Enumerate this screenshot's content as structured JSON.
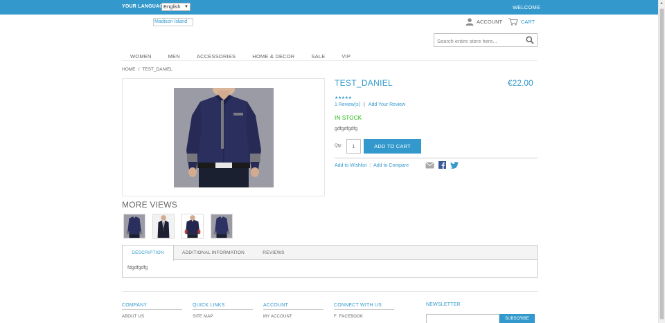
{
  "topbar": {
    "language_label": "YOUR LANGUAGE:",
    "language_value": "English",
    "welcome": "WELCOME"
  },
  "header": {
    "logo_alt": "Madison Island",
    "account": "ACCOUNT",
    "cart": "CART",
    "search_placeholder": "Search entire store here..."
  },
  "nav": [
    "WOMEN",
    "MEN",
    "ACCESSORIES",
    "HOME & DECOR",
    "SALE",
    "VIP"
  ],
  "breadcrumb": {
    "home": "HOME",
    "sep": "/",
    "current": "TEST_DANIEL"
  },
  "product": {
    "name": "TEST_DANIEL",
    "price": "€22.00",
    "rating_stars": "★★★★★",
    "reviews_count": "1 Review(s)",
    "reviews_sep": "|",
    "add_review": "Add Your Review",
    "availability": "IN STOCK",
    "short_description": "gdfgdfgdfg",
    "qty_label": "Qty:",
    "qty_value": "1",
    "add_to_cart": "ADD TO CART",
    "add_to_wishlist": "Add to Wishlist",
    "links_sep": "|",
    "add_to_compare": "Add to Compare"
  },
  "more_views": {
    "title": "MORE VIEWS",
    "count": 4
  },
  "tabs": {
    "items": [
      "DESCRIPTION",
      "ADDITIONAL INFORMATION",
      "REVIEWS"
    ],
    "active": "DESCRIPTION",
    "content": "fdgdfgdfg"
  },
  "footer": {
    "columns": [
      {
        "heading": "COMPANY",
        "link": "ABOUT US"
      },
      {
        "heading": "QUICK LINKS",
        "link": "SITE MAP"
      },
      {
        "heading": "ACCOUNT",
        "link": "MY ACCOUNT"
      },
      {
        "heading": "CONNECT WITH US",
        "link": "FACEBOOK"
      }
    ],
    "newsletter_heading": "NEWSLETTER",
    "subscribe": "SUBSCRIBE"
  },
  "colors": {
    "accent": "#3399cc",
    "stock": "#11b400",
    "text": "#636363",
    "shirt": "#2b2f5e"
  }
}
